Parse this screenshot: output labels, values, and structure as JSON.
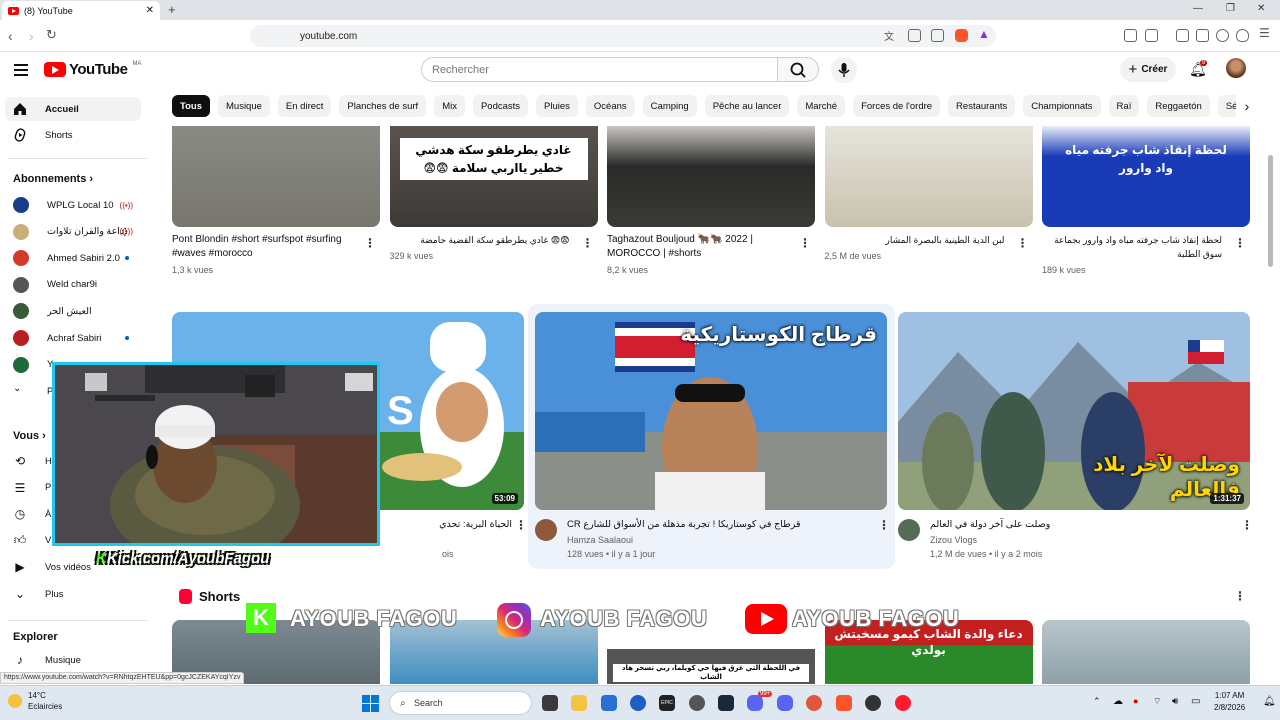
{
  "browser": {
    "tab_title": "(8) YouTube",
    "url": "youtube.com",
    "status_url": "https://www.youtube.com/watch?v=RNhtqzEHTEU&pp=0gcJCZEKAYcqIYzv"
  },
  "header": {
    "logo_text": "YouTube",
    "country_code": "MA",
    "search_placeholder": "Rechercher",
    "create_label": "Créer",
    "notification_count": "8"
  },
  "chips": [
    "Tous",
    "Musique",
    "En direct",
    "Planches de surf",
    "Mix",
    "Podcasts",
    "Pluies",
    "Océans",
    "Camping",
    "Pêche au lancer",
    "Marché",
    "Forces de l'ordre",
    "Restaurants",
    "Championnats",
    "Raï",
    "Reggaetón",
    "Séries"
  ],
  "sidebar": {
    "main": [
      {
        "label": "Accueil",
        "icon": "home-icon"
      },
      {
        "label": "Shorts",
        "icon": "shorts-icon"
      }
    ],
    "subscriptions_title": "Abonnements",
    "subscriptions": [
      {
        "label": "WPLG Local 10",
        "color": "#1a3a8a",
        "badge": "live"
      },
      {
        "label": "الإذاعة والقرآن تلاوات",
        "color": "#c9b07a",
        "badge": "live"
      },
      {
        "label": "Ahmed Sabiri 2.0",
        "color": "#d43a2a",
        "badge": "dot"
      },
      {
        "label": "Weld char9i",
        "color": "#555555",
        "badge": ""
      },
      {
        "label": "العيش الحر",
        "color": "#3b5a3a",
        "badge": ""
      },
      {
        "label": "Achraf Sabiri",
        "color": "#b82020",
        "badge": "dot"
      },
      {
        "label": "Y",
        "color": "#1d6a3a",
        "badge": ""
      },
      {
        "label": "P",
        "color": "",
        "badge": ""
      }
    ],
    "you_title": "Vous",
    "you_items": [
      {
        "label": "H",
        "icon": "history-icon"
      },
      {
        "label": "P",
        "icon": "playlists-icon"
      },
      {
        "label": "À",
        "icon": "watch-later-icon"
      },
      {
        "label": "V",
        "icon": "liked-icon"
      },
      {
        "label": "Vos vidéos",
        "icon": "your-videos-icon"
      },
      {
        "label": "Plus",
        "icon": "chevron-down-icon"
      }
    ],
    "explore_title": "Explorer",
    "explore_items": [
      {
        "label": "Musique",
        "icon": "music-icon"
      }
    ]
  },
  "shorts_row1": [
    {
      "title": "Pont Blondin #short #surfspot #surfing #waves #morocco",
      "views": "1,3 k vues",
      "thumb_text": ""
    },
    {
      "title": "😨😨 غادي يطرطقو سكة القضية حامضة",
      "views": "329 k vues",
      "thumb_text": "غادي يطرطقو سكة هدشي خطير يااربي سلامة 😨😨"
    },
    {
      "title": "Taghazout Bouljoud 🐂🐂 2022 | MOROCCO | #shorts",
      "views": "8,2 k vues",
      "thumb_text": ""
    },
    {
      "title": "لبن الدية الطينية بالبصرة المشار",
      "views": "2,5 M de vues",
      "thumb_text": ""
    },
    {
      "title": "لحظة إنقاذ شاب جرفته مياه واد وارور بجماعة سوق الطلبة",
      "views": "189 k vues",
      "thumb_text": "لحظة إنقاذ شاب جرفته مياه واد وارور"
    }
  ],
  "videos": [
    {
      "title": "الحياة البرية: تحدي",
      "channel": "",
      "meta": "ois",
      "duration": "53:09",
      "thumb_text": "S"
    },
    {
      "title": "قرطاج في كوستاريكا ! تجربة مذهلة من الأسواق للشارع CR",
      "channel": "Hamza Saalaoui",
      "meta": "128 vues • il y a 1 jour",
      "duration": "",
      "thumb_text": "قرطاج الكوستاريكية"
    },
    {
      "title": "وصلت على آخر دولة في العالم",
      "channel": "Zizou Vlogs",
      "meta": "1,2 M de vues • il y a 2 mois",
      "duration": "1:31:37",
      "thumb_text": "وصلت لآخر بلاد فالعالم"
    }
  ],
  "shorts_section": {
    "title": "Shorts",
    "thumb_texts": [
      "",
      "",
      "في اللحظة التي غرق فيها حي كويلما، ربي تسخر هاد الشاب",
      "دعاء والدة الشاب كيمو مسخيتش بولدي",
      ""
    ]
  },
  "overlay": {
    "kick_handle": "Kick.com/AyoubFagou",
    "brand1": "AYOUB FAGOU",
    "brand2": "AYOUB FAGOU",
    "brand3": "AYOUB FAGOU"
  },
  "taskbar": {
    "temperature": "14°C",
    "weather": "Eclaircies",
    "search_label": "Search",
    "time": "1:07 AM",
    "date": "2/8/2026",
    "discord_badge": "99+"
  }
}
